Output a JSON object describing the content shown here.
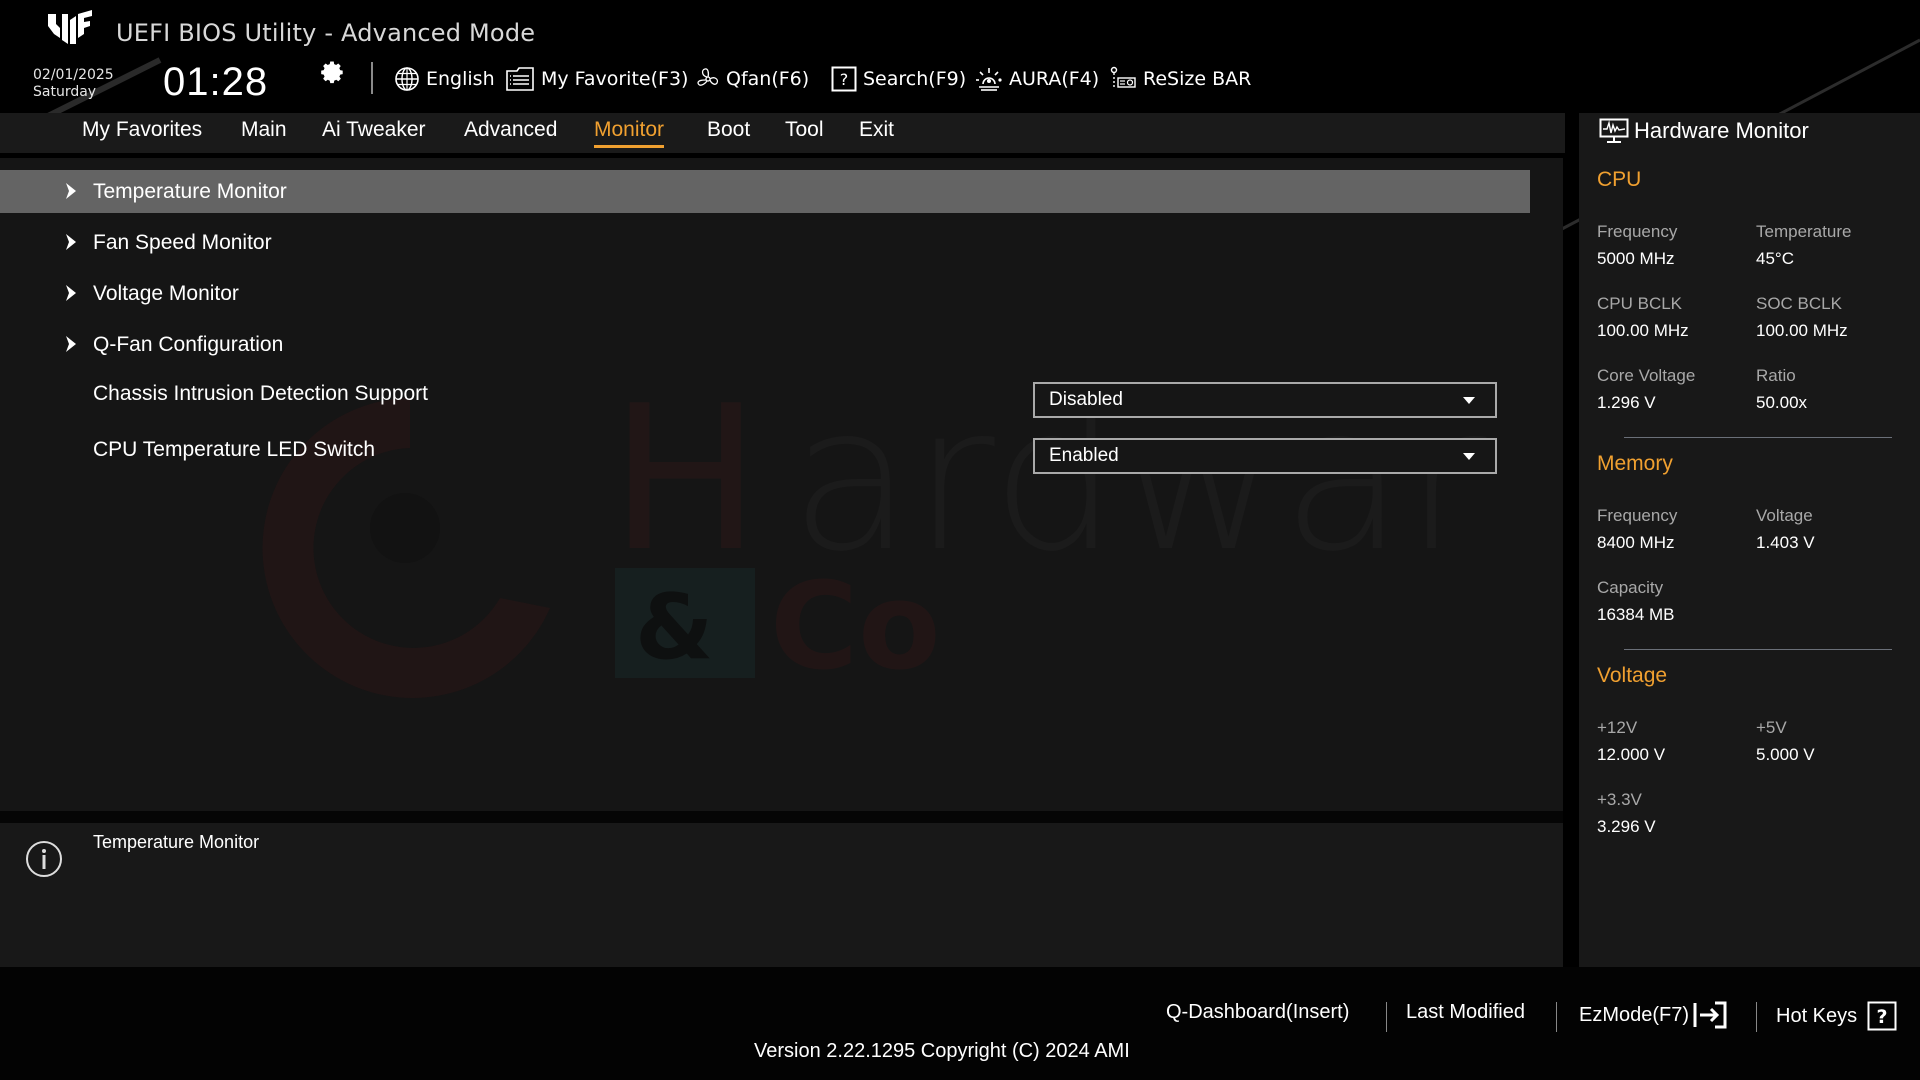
{
  "header": {
    "title": "UEFI BIOS Utility - Advanced Mode",
    "date": "02/01/2025",
    "weekday": "Saturday",
    "time": "01:28"
  },
  "toolbar": {
    "items": [
      {
        "label": "English",
        "icon": "globe-icon"
      },
      {
        "label": "My Favorite(F3)",
        "icon": "favorite-list-icon"
      },
      {
        "label": "Qfan(F6)",
        "icon": "fan-icon"
      },
      {
        "label": "Search(F9)",
        "icon": "search-help-icon"
      },
      {
        "label": "AURA(F4)",
        "icon": "aura-light-icon"
      },
      {
        "label": "ReSize BAR",
        "icon": "resize-bar-icon"
      }
    ]
  },
  "nav": {
    "tabs": [
      {
        "label": "My Favorites"
      },
      {
        "label": "Main"
      },
      {
        "label": "Ai Tweaker"
      },
      {
        "label": "Advanced"
      },
      {
        "label": "Monitor",
        "active": true
      },
      {
        "label": "Boot"
      },
      {
        "label": "Tool"
      },
      {
        "label": "Exit"
      }
    ]
  },
  "main": {
    "submenus": [
      {
        "label": "Temperature Monitor",
        "selected": true
      },
      {
        "label": "Fan Speed Monitor"
      },
      {
        "label": "Voltage Monitor"
      },
      {
        "label": "Q-Fan Configuration"
      }
    ],
    "settings": [
      {
        "label": "Chassis Intrusion Detection Support",
        "value": "Disabled"
      },
      {
        "label": "CPU Temperature LED Switch",
        "value": "Enabled"
      }
    ]
  },
  "info": {
    "text": "Temperature Monitor"
  },
  "hardware_monitor": {
    "title": "Hardware Monitor",
    "cpu": {
      "title": "CPU",
      "frequency_label": "Frequency",
      "frequency": "5000 MHz",
      "temperature_label": "Temperature",
      "temperature": "45°C",
      "cpu_bclk_label": "CPU BCLK",
      "cpu_bclk": "100.00 MHz",
      "soc_bclk_label": "SOC BCLK",
      "soc_bclk": "100.00 MHz",
      "core_voltage_label": "Core Voltage",
      "core_voltage": "1.296 V",
      "ratio_label": "Ratio",
      "ratio": "50.00x"
    },
    "memory": {
      "title": "Memory",
      "frequency_label": "Frequency",
      "frequency": "8400 MHz",
      "voltage_label": "Voltage",
      "voltage": "1.403 V",
      "capacity_label": "Capacity",
      "capacity": "16384 MB"
    },
    "voltage": {
      "title": "Voltage",
      "v12_label": "+12V",
      "v12": "12.000 V",
      "v5_label": "+5V",
      "v5": "5.000 V",
      "v33_label": "+3.3V",
      "v33": "3.296 V"
    }
  },
  "footer": {
    "qdashboard": "Q-Dashboard(Insert)",
    "last_modified": "Last Modified",
    "ezmode": "EzMode(F7)",
    "hotkeys": "Hot Keys",
    "version": "Version 2.22.1295 Copyright (C) 2024 AMI"
  },
  "colors": {
    "accent": "#f0a030",
    "selected_row": "#646464",
    "panel_bg": "#151515",
    "header_bg": "#000000"
  }
}
